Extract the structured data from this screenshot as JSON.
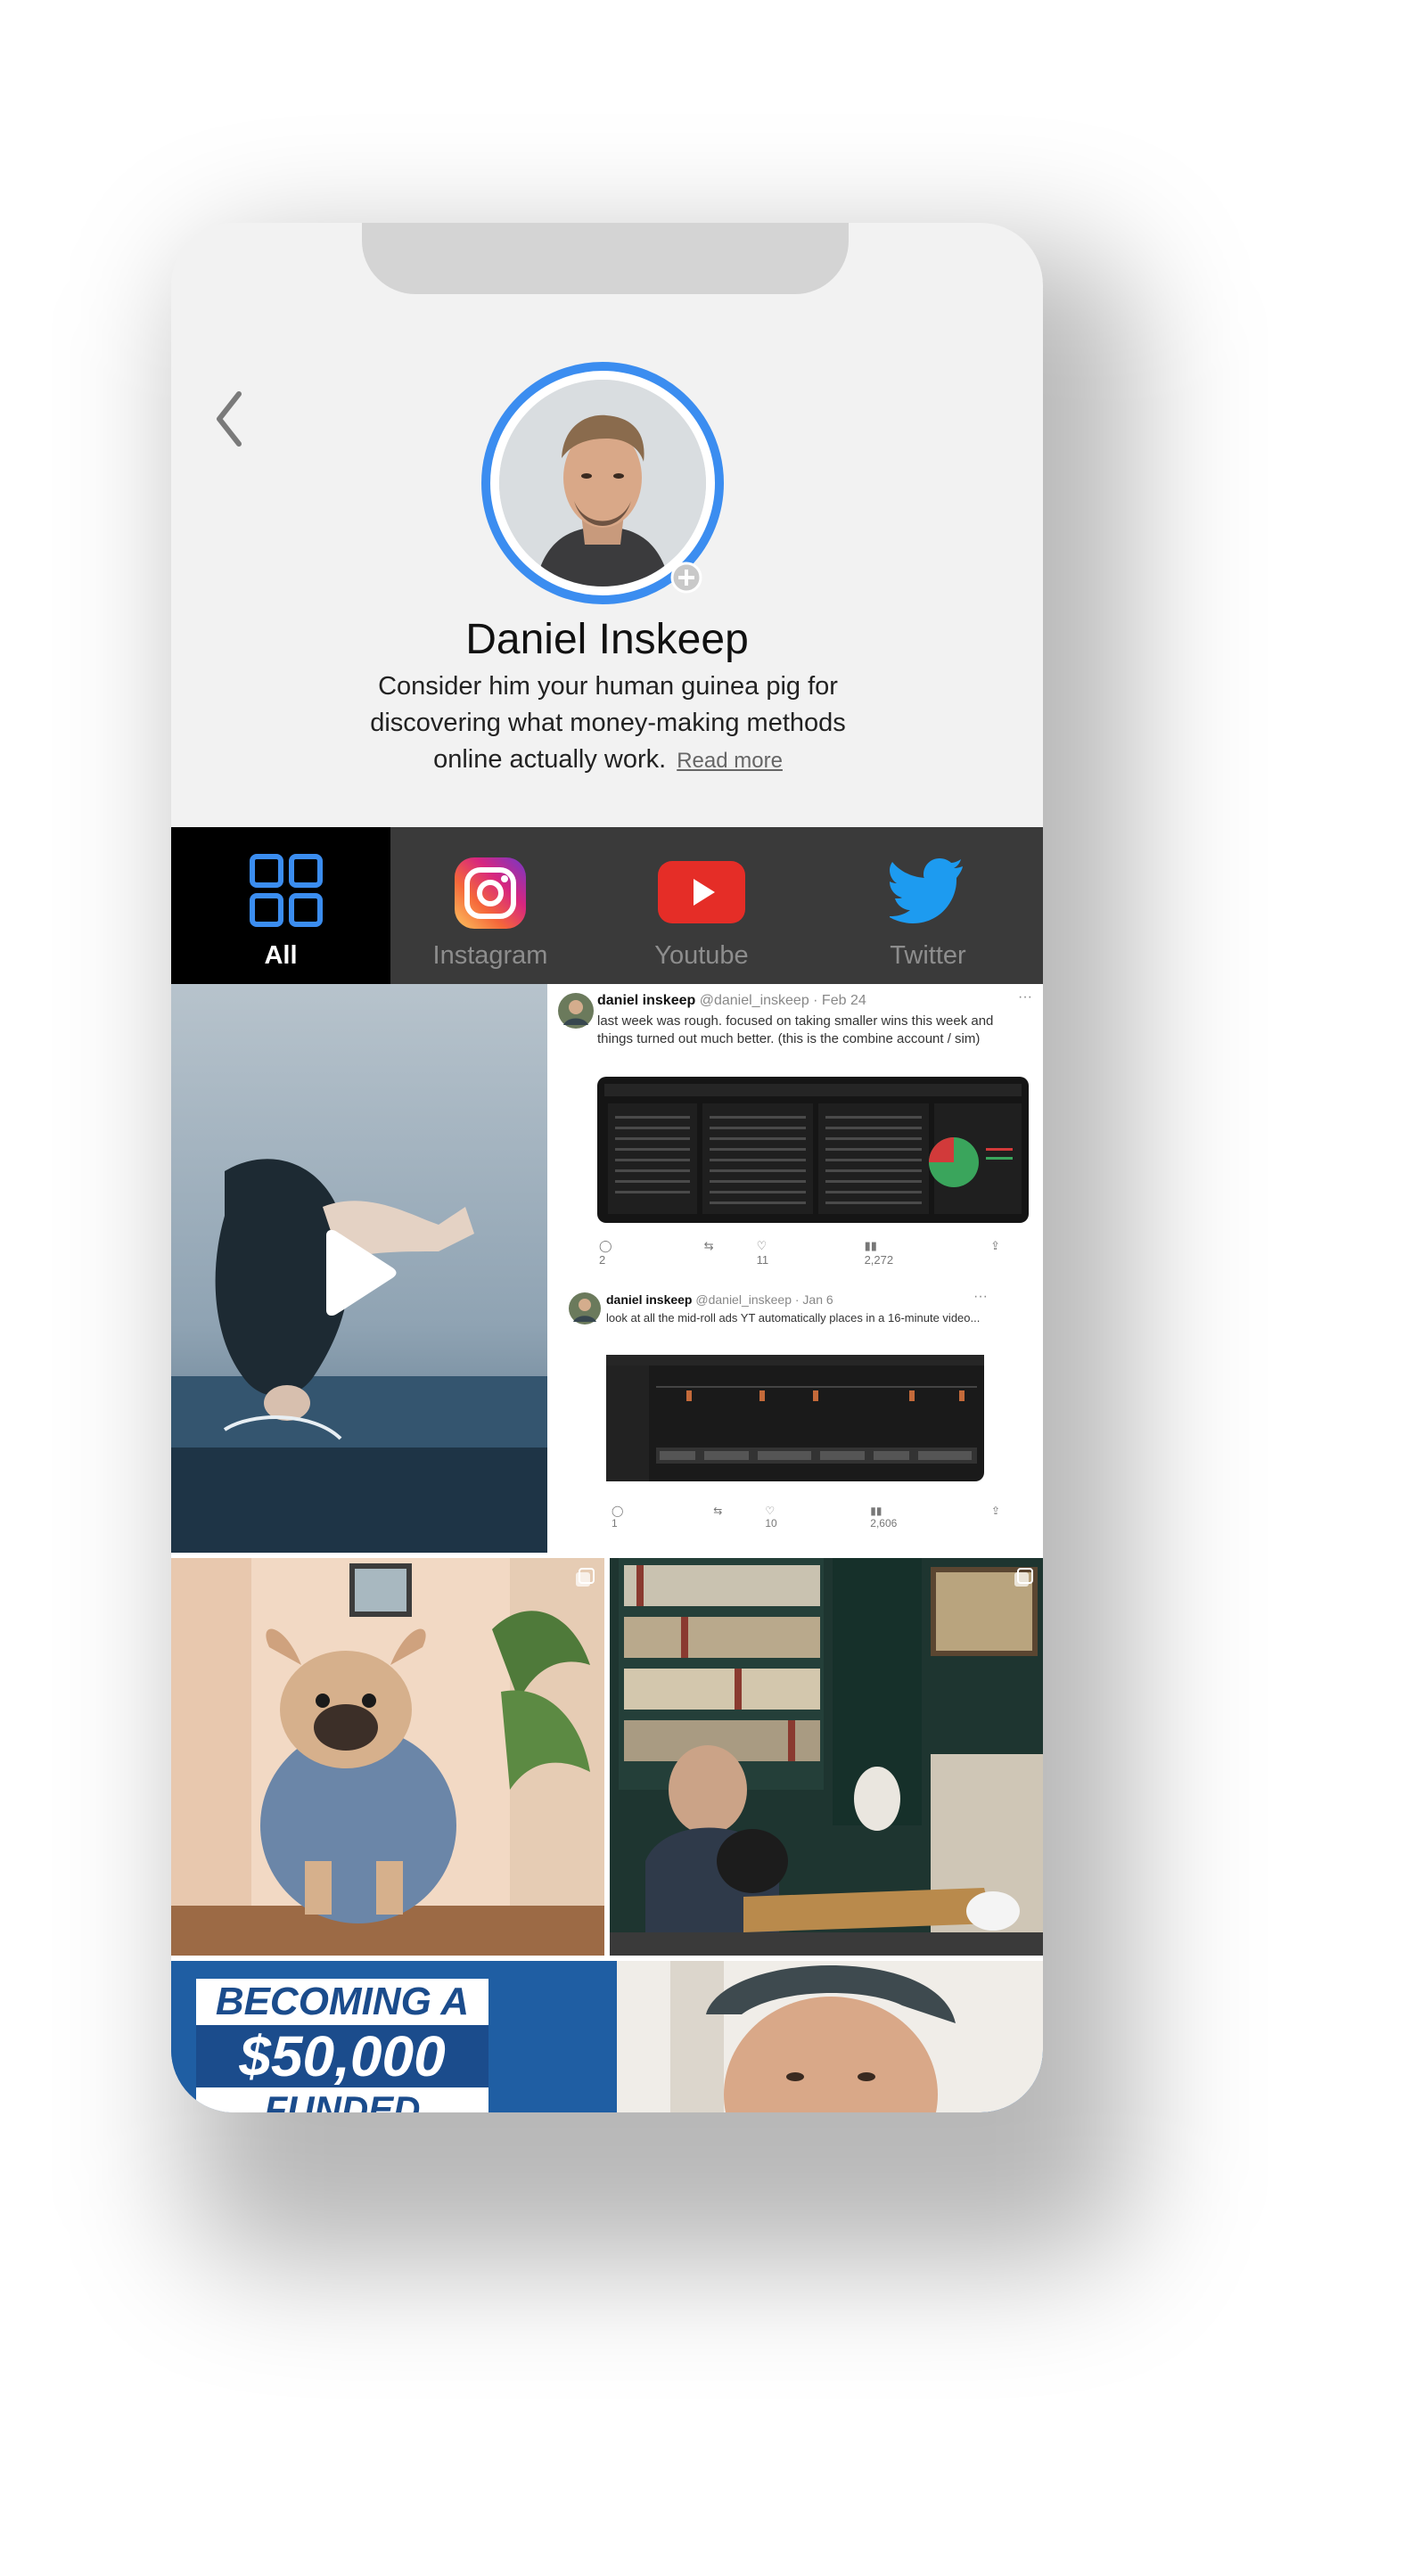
{
  "profile": {
    "name": "Daniel Inskeep",
    "bio": "Consider him your human guinea pig for discovering what money-making methods online actually work.",
    "read_more": "Read more"
  },
  "tabs": [
    {
      "label": "All",
      "icon": "grid-icon",
      "active": true
    },
    {
      "label": "Instagram",
      "icon": "instagram-icon",
      "active": false
    },
    {
      "label": "Youtube",
      "icon": "youtube-icon",
      "active": false
    },
    {
      "label": "Twitter",
      "icon": "twitter-icon",
      "active": false
    }
  ],
  "tweets": [
    {
      "name": "daniel inskeep",
      "handle": "@daniel_inskeep · Feb 24",
      "text": "last week was rough. focused on taking smaller wins this week and things turned out much better. (this is the combine account / sim)",
      "replies": "2",
      "likes": "11",
      "views": "2,272"
    },
    {
      "name": "daniel inskeep",
      "handle": "@daniel_inskeep · Jan 6",
      "text": "look at all the mid-roll ads YT automatically places in a 16-minute video...",
      "replies": "1",
      "likes": "10",
      "views": "2,606"
    }
  ],
  "youtube_thumb": {
    "line1": "BECOMING A",
    "line2": "$50,000",
    "line3": "FUNDED TRADER"
  },
  "colors": {
    "accent_blue": "#3b8df0",
    "tab_bar": "#3a3a3a",
    "active_tab": "#000000",
    "youtube_red": "#e52d27",
    "twitter_blue": "#1d9bf0"
  }
}
